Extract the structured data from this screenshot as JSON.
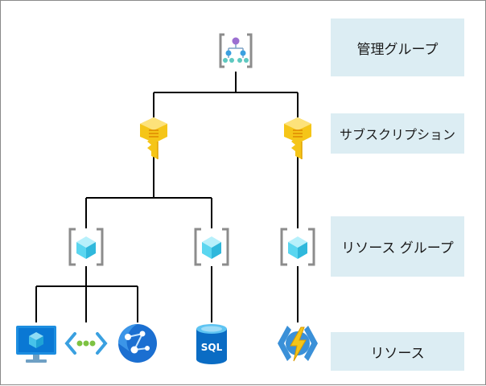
{
  "labels": {
    "management_group": "管理グループ",
    "subscription": "サブスクリプション",
    "resource_group": "リソース グループ",
    "resource": "リソース"
  },
  "icons": {
    "management_group": "management-group-icon",
    "subscription_left": "key-icon",
    "subscription_right": "key-icon",
    "resource_group_1": "resource-group-icon",
    "resource_group_2": "resource-group-icon",
    "resource_group_3": "resource-group-icon",
    "resource_vm": "virtual-machine-icon",
    "resource_network": "virtual-network-icon",
    "resource_web": "web-app-icon",
    "resource_sql": "sql-database-icon",
    "resource_function": "function-app-icon"
  },
  "sql_label": "SQL",
  "colors": {
    "label_background": "#dcedf3",
    "connector": "#000000",
    "key_gold": "#f5c518",
    "cube_cyan": "#5ad6f0",
    "bracket_gray": "#8c8c8c",
    "azure_blue": "#0a78d4"
  }
}
